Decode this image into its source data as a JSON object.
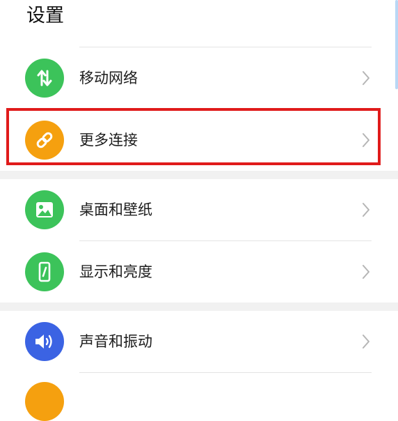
{
  "header": {
    "title": "设置"
  },
  "colors": {
    "mobile_network": "#3cc35a",
    "more_connections": "#f5a00f",
    "wallpaper": "#3cc35a",
    "display": "#3cc35a",
    "sound": "#3b63e3",
    "partial_next": "#f5a00f",
    "highlight": "#e01b1b"
  },
  "settings": {
    "items": [
      {
        "label": "移动网络",
        "icon": "mobile-data-arrows-icon"
      },
      {
        "label": "更多连接",
        "icon": "link-icon"
      },
      {
        "label": "桌面和壁纸",
        "icon": "image-icon"
      },
      {
        "label": "显示和亮度",
        "icon": "phone-brightness-icon"
      },
      {
        "label": "声音和振动",
        "icon": "speaker-icon"
      }
    ]
  }
}
